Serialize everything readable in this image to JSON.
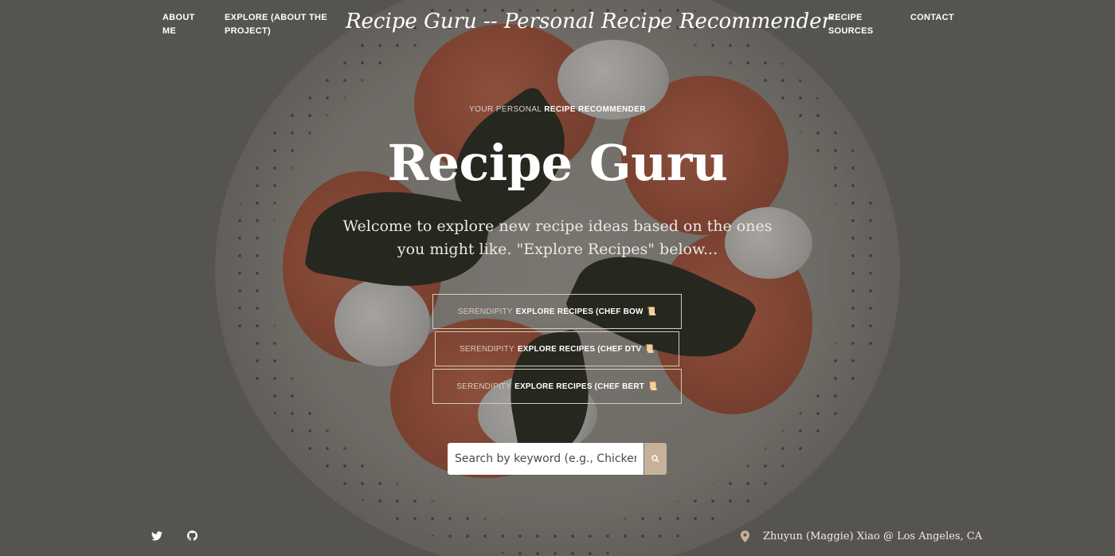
{
  "nav": {
    "about_line1": "ABOUT",
    "about_line2": "ME",
    "explore_line1": "EXPLORE (ABOUT THE",
    "explore_line2": "PROJECT)",
    "site_title": "Recipe Guru -- Personal Recipe Recommender",
    "sources_line1": "RECIPE",
    "sources_line2": "SOURCES",
    "contact": "CONTACT"
  },
  "hero": {
    "kicker_light": "YOUR PERSONAL",
    "kicker_bold": "RECIPE RECOMMENDER",
    "title": "Recipe Guru",
    "subtitle_line1": "Welcome to explore new recipe ideas based on the ones",
    "subtitle_line2": "you might like. \"Explore Recipes\" below..."
  },
  "buttons": [
    {
      "light": "SERENDIPITY",
      "bold": "EXPLORE RECIPES (CHEF BOW",
      "icon": "📜"
    },
    {
      "light": "SERENDIPITY",
      "bold": "EXPLORE RECIPES (CHEF DTV",
      "icon": "📜"
    },
    {
      "light": "SERENDIPITY",
      "bold": "EXPLORE RECIPES (CHEF BERT",
      "icon": "📜"
    }
  ],
  "search": {
    "placeholder": "Search by keyword (e.g., Chicken)",
    "icon": "search-icon"
  },
  "footer": {
    "location_icon": "map-pin-icon",
    "author": "Zhuyun (Maggie) Xiao @ Los Angeles, CA",
    "social_icons": [
      "twitter-icon",
      "github-icon"
    ]
  },
  "colors": {
    "accent": "#c7b299",
    "border": "#d8c9b6",
    "text": "#ffffff"
  }
}
